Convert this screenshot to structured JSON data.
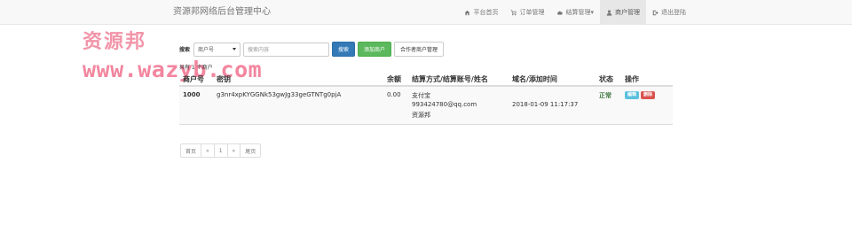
{
  "header": {
    "brand": "资源邦网络后台管理中心",
    "nav": [
      {
        "label": "平台首页",
        "icon": "home-icon"
      },
      {
        "label": "订单管理",
        "icon": "cart-icon"
      },
      {
        "label": "结算管理▾",
        "icon": "cloud-icon"
      },
      {
        "label": "商户管理",
        "icon": "user-icon"
      },
      {
        "label": "退出登陆",
        "icon": "logout-icon"
      }
    ]
  },
  "watermark": {
    "text_cn": "资源邦",
    "url": "www.wazyb.com"
  },
  "search": {
    "label": "搜索",
    "select_value": "商户号",
    "input_placeholder": "搜索内容",
    "search_button": "搜索",
    "add_button": "添加商户",
    "partner_button": "合作者商户管理"
  },
  "count_text": "共有 1 个商户",
  "table": {
    "headers": [
      "商户号",
      "密钥",
      "余额",
      "结算方式/结算账号/姓名",
      "域名/添加时间",
      "状态",
      "操作"
    ],
    "rows": [
      {
        "id": "1000",
        "key": "g3nr4xpKYGGNk53gwJg33geGTNTg0pjA",
        "balance": "0.00",
        "settle_method": "支付宝",
        "settle_account": "993424780@qq.com",
        "settle_name": "资源邦",
        "time": "2018-01-09 11:17:37",
        "status": "正常",
        "edit": "编辑",
        "delete": "删除"
      }
    ]
  },
  "pagination": [
    "首页",
    "«",
    "1",
    "»",
    "尾页"
  ]
}
